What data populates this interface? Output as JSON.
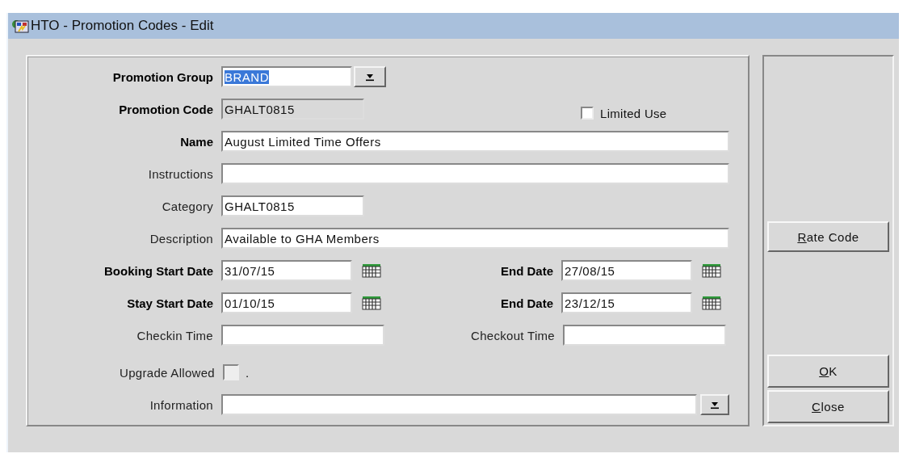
{
  "window": {
    "title": "HTO - Promotion Codes - Edit"
  },
  "form": {
    "promotion_group": {
      "label": "Promotion Group",
      "required": true,
      "value": "BRAND",
      "selected": true
    },
    "promotion_code": {
      "label": "Promotion Code",
      "required": true,
      "value": "GHALT0815",
      "disabled": true
    },
    "limited_use": {
      "label": "Limited Use",
      "checked": false
    },
    "name": {
      "label": "Name",
      "required": true,
      "value": "August Limited Time Offers"
    },
    "instructions": {
      "label": "Instructions",
      "required": false
    },
    "category": {
      "label": "Category",
      "required": false,
      "value": "GHALT0815"
    },
    "description": {
      "label": "Description",
      "required": false,
      "value": "Available to GHA Members"
    },
    "booking_start": {
      "label": "Booking Start Date",
      "required": true,
      "value": "31/07/15"
    },
    "booking_end": {
      "label": "End Date",
      "required": true,
      "value": "27/08/15"
    },
    "stay_start": {
      "label": "Stay Start Date",
      "required": true,
      "value": "01/10/15"
    },
    "stay_end": {
      "label": "End Date",
      "required": true,
      "value": "23/12/15"
    },
    "checkin_time": {
      "label": "Checkin Time",
      "required": false
    },
    "checkout_time": {
      "label": "Checkout Time",
      "required": false
    },
    "upgrade_allowed": {
      "label": "Upgrade Allowed",
      "checked": false,
      "suffix": "."
    },
    "information": {
      "label": "Information",
      "required": false
    }
  },
  "buttons": [
    {
      "label": "Rate Code"
    },
    {
      "label": "OK"
    },
    {
      "label": "Close"
    }
  ]
}
